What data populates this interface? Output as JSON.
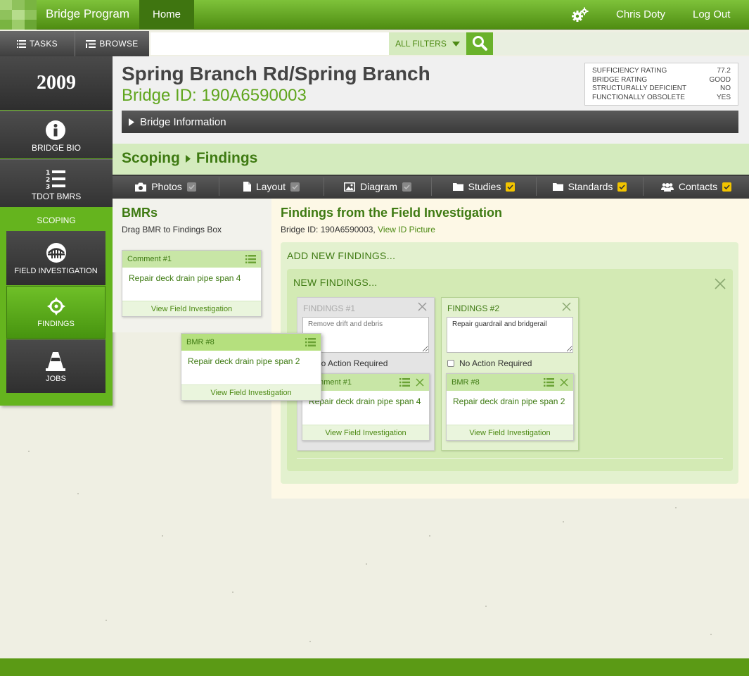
{
  "app": {
    "title": "Bridge Program",
    "home_tab": "Home",
    "user": "Chris Doty",
    "logout": "Log Out"
  },
  "navbar": {
    "tasks": "TASKS",
    "browse": "BROWSE",
    "search_placeholder": "",
    "filters": "ALL FILTERS"
  },
  "sidebar": {
    "year": "2009",
    "items": [
      {
        "label": "BRIDGE BIO",
        "icon": "info-icon"
      },
      {
        "label": "TDOT BMRS",
        "icon": "numbered-list-icon"
      }
    ],
    "section": "SCOPING",
    "subitems": [
      {
        "label": "FIELD INVESTIGATION",
        "icon": "bridge-icon"
      },
      {
        "label": "FINDINGS",
        "icon": "crosshair-icon",
        "active": true
      },
      {
        "label": "JOBS",
        "icon": "traffic-cone-icon"
      }
    ]
  },
  "bridge": {
    "name": "Spring Branch Rd/Spring Branch",
    "id_line": "Bridge ID: 190A6590003",
    "ratings": [
      {
        "label": "SUFFICIENCY RATING",
        "value": "77.2"
      },
      {
        "label": "BRIDGE RATING",
        "value": "GOOD"
      },
      {
        "label": "STRUCTURALLY DEFICIENT",
        "value": "NO"
      },
      {
        "label": "FUNCTIONALLY OBSOLETE",
        "value": "YES"
      }
    ],
    "info_bar": "Bridge Information"
  },
  "breadcrumb": {
    "parent": "Scoping",
    "current": "Findings"
  },
  "tabs": [
    {
      "label": "Photos",
      "icon": "camera-icon",
      "checked": false
    },
    {
      "label": "Layout",
      "icon": "document-icon",
      "checked": false
    },
    {
      "label": "Diagram",
      "icon": "image-icon",
      "checked": false
    },
    {
      "label": "Studies",
      "icon": "folder-icon",
      "checked": true
    },
    {
      "label": "Standards",
      "icon": "folder-icon",
      "checked": true
    },
    {
      "label": "Contacts",
      "icon": "users-icon",
      "checked": true
    }
  ],
  "bmrs": {
    "title": "BMRs",
    "subtitle": "Drag BMR to Findings Box",
    "cards": [
      {
        "head": "Comment #1",
        "body": "Repair deck drain pipe span 4",
        "link": "View Field Investigation"
      },
      {
        "head": "BMR #8",
        "body": "Repair deck drain pipe span 2",
        "link": "View Field Investigation"
      }
    ]
  },
  "findings": {
    "title": "Findings from the Field Investigation",
    "sub_prefix": "Bridge ID: 190A6590003,",
    "sub_link": "View ID Picture",
    "add_new": "ADD NEW FINDINGS...",
    "new": "NEW FINDINGS...",
    "boxes": [
      {
        "head": "FINDINGS #1",
        "placeholder": "Remove drift and debris",
        "value": "",
        "no_action": "No Action Required",
        "attached": {
          "head": "Comment #1",
          "body": "Repair deck drain pipe span 4",
          "link": "View Field Investigation"
        }
      },
      {
        "head": "FINDINGS #2",
        "placeholder": "",
        "value": "Repair guardrail and bridgerail",
        "no_action": "No Action Required",
        "attached": {
          "head": "BMR #8",
          "body": "Repair deck drain pipe span 2",
          "link": "View Field Investigation"
        }
      }
    ]
  },
  "colors": {
    "brand_green": "#65b41e",
    "dark_green": "#3e7a12",
    "check_yellow": "#f2c400"
  }
}
